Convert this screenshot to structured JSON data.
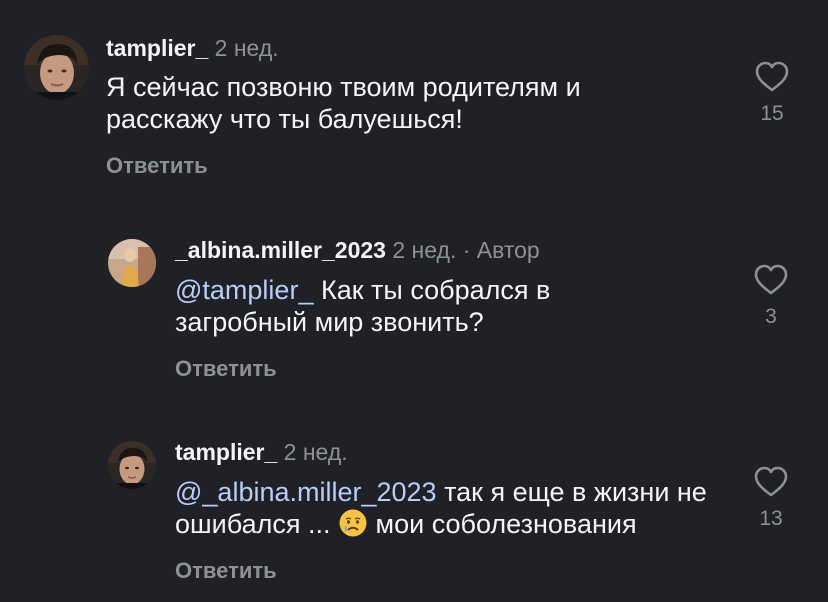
{
  "comments": [
    {
      "username": "tamplier_",
      "time": "2 нед.",
      "text": "Я сейчас позвоню твоим родителям и расскажу что ты балуешься!",
      "reply_label": "Ответить",
      "likes": "15",
      "avatar_icon": "avatar-man-photo"
    },
    {
      "username": "_albina.miller_2023",
      "time": "2 нед.",
      "author_tag": "· Автор",
      "mention": "@tamplier_",
      "text": "Как ты собрался в загробный мир звонить?",
      "reply_label": "Ответить",
      "likes": "3",
      "avatar_icon": "avatar-woman-photo"
    },
    {
      "username": "tamplier_",
      "time": "2 нед.",
      "mention": "@_albina.miller_2023",
      "text_before_emoji": "так я еще в жизни не ошибался ...",
      "emoji": "crying-face-emoji",
      "text_after_emoji": "мои соболезнования",
      "reply_label": "Ответить",
      "likes": "13",
      "avatar_icon": "avatar-man-photo"
    }
  ],
  "colors": {
    "background": "#1f2127",
    "primary_text": "#f5f5f5",
    "secondary_text": "#8e9096",
    "mention": "#b9cdf6"
  }
}
